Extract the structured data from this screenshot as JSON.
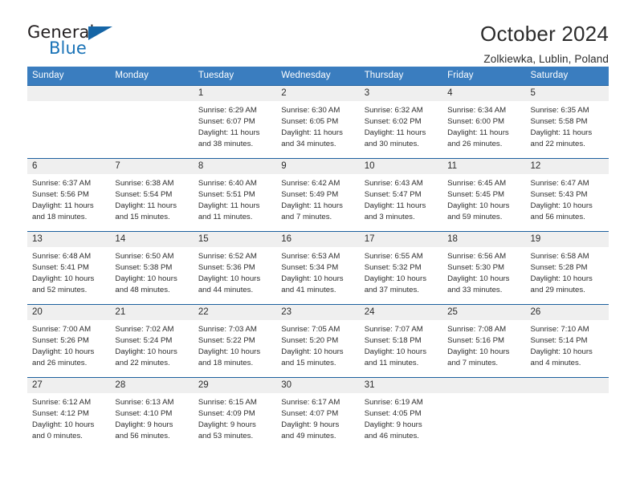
{
  "brand": {
    "name_top": "General",
    "name_bottom": "Blue",
    "flag_icon": "triangle-flag-icon",
    "accent_color": "#1565a6"
  },
  "header": {
    "title": "October 2024",
    "location": "Zolkiewka, Lublin, Poland"
  },
  "calendar": {
    "header_bg": "#3a7dbf",
    "row_divider": "#1c5f9e",
    "daynum_bg": "#efefef",
    "weekdays": [
      "Sunday",
      "Monday",
      "Tuesday",
      "Wednesday",
      "Thursday",
      "Friday",
      "Saturday"
    ],
    "weeks": [
      [
        {
          "day": "",
          "lines": []
        },
        {
          "day": "",
          "lines": []
        },
        {
          "day": "1",
          "lines": [
            "Sunrise: 6:29 AM",
            "Sunset: 6:07 PM",
            "Daylight: 11 hours and 38 minutes."
          ]
        },
        {
          "day": "2",
          "lines": [
            "Sunrise: 6:30 AM",
            "Sunset: 6:05 PM",
            "Daylight: 11 hours and 34 minutes."
          ]
        },
        {
          "day": "3",
          "lines": [
            "Sunrise: 6:32 AM",
            "Sunset: 6:02 PM",
            "Daylight: 11 hours and 30 minutes."
          ]
        },
        {
          "day": "4",
          "lines": [
            "Sunrise: 6:34 AM",
            "Sunset: 6:00 PM",
            "Daylight: 11 hours and 26 minutes."
          ]
        },
        {
          "day": "5",
          "lines": [
            "Sunrise: 6:35 AM",
            "Sunset: 5:58 PM",
            "Daylight: 11 hours and 22 minutes."
          ]
        }
      ],
      [
        {
          "day": "6",
          "lines": [
            "Sunrise: 6:37 AM",
            "Sunset: 5:56 PM",
            "Daylight: 11 hours and 18 minutes."
          ]
        },
        {
          "day": "7",
          "lines": [
            "Sunrise: 6:38 AM",
            "Sunset: 5:54 PM",
            "Daylight: 11 hours and 15 minutes."
          ]
        },
        {
          "day": "8",
          "lines": [
            "Sunrise: 6:40 AM",
            "Sunset: 5:51 PM",
            "Daylight: 11 hours and 11 minutes."
          ]
        },
        {
          "day": "9",
          "lines": [
            "Sunrise: 6:42 AM",
            "Sunset: 5:49 PM",
            "Daylight: 11 hours and 7 minutes."
          ]
        },
        {
          "day": "10",
          "lines": [
            "Sunrise: 6:43 AM",
            "Sunset: 5:47 PM",
            "Daylight: 11 hours and 3 minutes."
          ]
        },
        {
          "day": "11",
          "lines": [
            "Sunrise: 6:45 AM",
            "Sunset: 5:45 PM",
            "Daylight: 10 hours and 59 minutes."
          ]
        },
        {
          "day": "12",
          "lines": [
            "Sunrise: 6:47 AM",
            "Sunset: 5:43 PM",
            "Daylight: 10 hours and 56 minutes."
          ]
        }
      ],
      [
        {
          "day": "13",
          "lines": [
            "Sunrise: 6:48 AM",
            "Sunset: 5:41 PM",
            "Daylight: 10 hours and 52 minutes."
          ]
        },
        {
          "day": "14",
          "lines": [
            "Sunrise: 6:50 AM",
            "Sunset: 5:38 PM",
            "Daylight: 10 hours and 48 minutes."
          ]
        },
        {
          "day": "15",
          "lines": [
            "Sunrise: 6:52 AM",
            "Sunset: 5:36 PM",
            "Daylight: 10 hours and 44 minutes."
          ]
        },
        {
          "day": "16",
          "lines": [
            "Sunrise: 6:53 AM",
            "Sunset: 5:34 PM",
            "Daylight: 10 hours and 41 minutes."
          ]
        },
        {
          "day": "17",
          "lines": [
            "Sunrise: 6:55 AM",
            "Sunset: 5:32 PM",
            "Daylight: 10 hours and 37 minutes."
          ]
        },
        {
          "day": "18",
          "lines": [
            "Sunrise: 6:56 AM",
            "Sunset: 5:30 PM",
            "Daylight: 10 hours and 33 minutes."
          ]
        },
        {
          "day": "19",
          "lines": [
            "Sunrise: 6:58 AM",
            "Sunset: 5:28 PM",
            "Daylight: 10 hours and 29 minutes."
          ]
        }
      ],
      [
        {
          "day": "20",
          "lines": [
            "Sunrise: 7:00 AM",
            "Sunset: 5:26 PM",
            "Daylight: 10 hours and 26 minutes."
          ]
        },
        {
          "day": "21",
          "lines": [
            "Sunrise: 7:02 AM",
            "Sunset: 5:24 PM",
            "Daylight: 10 hours and 22 minutes."
          ]
        },
        {
          "day": "22",
          "lines": [
            "Sunrise: 7:03 AM",
            "Sunset: 5:22 PM",
            "Daylight: 10 hours and 18 minutes."
          ]
        },
        {
          "day": "23",
          "lines": [
            "Sunrise: 7:05 AM",
            "Sunset: 5:20 PM",
            "Daylight: 10 hours and 15 minutes."
          ]
        },
        {
          "day": "24",
          "lines": [
            "Sunrise: 7:07 AM",
            "Sunset: 5:18 PM",
            "Daylight: 10 hours and 11 minutes."
          ]
        },
        {
          "day": "25",
          "lines": [
            "Sunrise: 7:08 AM",
            "Sunset: 5:16 PM",
            "Daylight: 10 hours and 7 minutes."
          ]
        },
        {
          "day": "26",
          "lines": [
            "Sunrise: 7:10 AM",
            "Sunset: 5:14 PM",
            "Daylight: 10 hours and 4 minutes."
          ]
        }
      ],
      [
        {
          "day": "27",
          "lines": [
            "Sunrise: 6:12 AM",
            "Sunset: 4:12 PM",
            "Daylight: 10 hours and 0 minutes."
          ]
        },
        {
          "day": "28",
          "lines": [
            "Sunrise: 6:13 AM",
            "Sunset: 4:10 PM",
            "Daylight: 9 hours and 56 minutes."
          ]
        },
        {
          "day": "29",
          "lines": [
            "Sunrise: 6:15 AM",
            "Sunset: 4:09 PM",
            "Daylight: 9 hours and 53 minutes."
          ]
        },
        {
          "day": "30",
          "lines": [
            "Sunrise: 6:17 AM",
            "Sunset: 4:07 PM",
            "Daylight: 9 hours and 49 minutes."
          ]
        },
        {
          "day": "31",
          "lines": [
            "Sunrise: 6:19 AM",
            "Sunset: 4:05 PM",
            "Daylight: 9 hours and 46 minutes."
          ]
        },
        {
          "day": "",
          "lines": []
        },
        {
          "day": "",
          "lines": []
        }
      ]
    ]
  }
}
